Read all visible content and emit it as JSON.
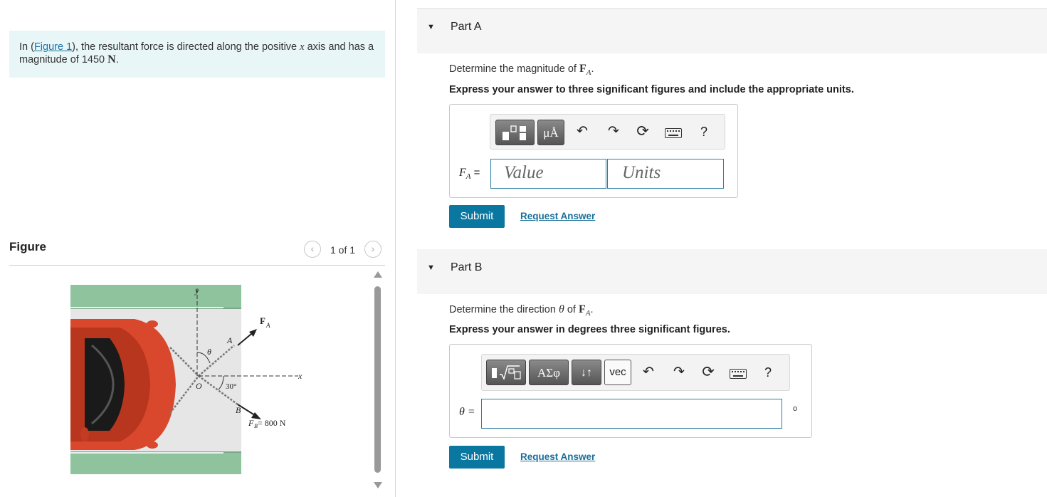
{
  "problem": {
    "prefix": "In (",
    "figure_link": "Figure 1",
    "middle": "), the resultant force is directed along the positive ",
    "axis_var": "x",
    "suffix": " axis and has a magnitude of 1450 ",
    "unit": "N",
    "end": "."
  },
  "figure_panel": {
    "title": "Figure",
    "pager_label": "1 of 1",
    "labels": {
      "y": "y",
      "x": "x",
      "fa": "F",
      "fa_sub": "A",
      "a": "A",
      "b": "B",
      "o": "O",
      "theta": "θ",
      "angle": "30°",
      "fb": "F",
      "fb_sub": "B",
      "fb_value": " = 800 N"
    }
  },
  "partA": {
    "title": "Part A",
    "question_prefix": "Determine the magnitude of ",
    "question_var": "F",
    "question_sub": "A",
    "question_end": ".",
    "instruction": "Express your answer to three significant figures and include the appropriate units.",
    "toolbar": [
      "templates",
      "μÅ",
      "undo",
      "redo",
      "reset",
      "keyboard",
      "?"
    ],
    "var_label": "F",
    "var_sub": "A",
    "equals": " =",
    "value_placeholder": "Value",
    "units_placeholder": "Units",
    "submit": "Submit",
    "request": "Request Answer"
  },
  "partB": {
    "title": "Part B",
    "question_prefix": "Determine the direction ",
    "question_theta": "θ",
    "question_mid": " of ",
    "question_var": "F",
    "question_sub": "A",
    "question_end": ".",
    "instruction": "Express your answer in degrees three significant figures.",
    "toolbar": [
      "templates",
      "ΑΣφ",
      "↓↑",
      "vec",
      "undo",
      "redo",
      "reset",
      "keyboard",
      "?"
    ],
    "var_label": "θ =",
    "unit_symbol": "o",
    "submit": "Submit",
    "request": "Request Answer"
  },
  "colors": {
    "accent": "#0a77a0",
    "link": "#1a6f9a",
    "intro_bg": "#e9f6f7",
    "car": "#d9482c",
    "grass": "#8fc39d"
  }
}
